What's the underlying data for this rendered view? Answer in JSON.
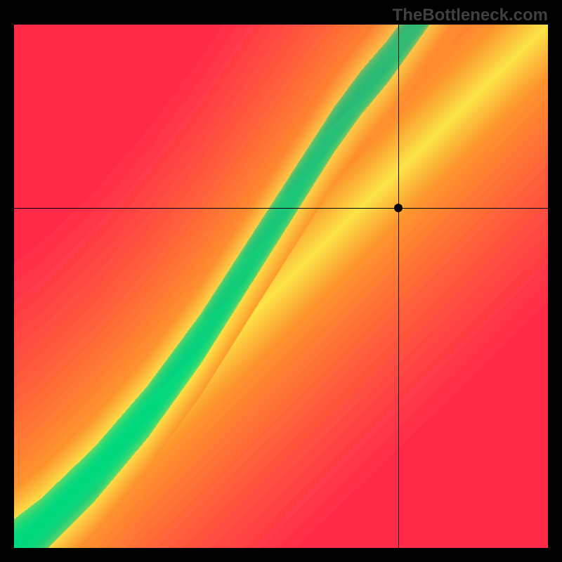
{
  "watermark": "TheBottleneck.com",
  "chart_data": {
    "type": "heatmap",
    "title": "",
    "xlabel": "",
    "ylabel": "",
    "xlim": [
      0,
      1
    ],
    "ylim": [
      0,
      1
    ],
    "marker": {
      "x": 0.72,
      "y": 0.65
    },
    "crosshair": {
      "x": 0.72,
      "y": 0.65
    },
    "optimal_curve": [
      {
        "x": 0.0,
        "y": 0.0
      },
      {
        "x": 0.05,
        "y": 0.04
      },
      {
        "x": 0.1,
        "y": 0.09
      },
      {
        "x": 0.15,
        "y": 0.14
      },
      {
        "x": 0.2,
        "y": 0.2
      },
      {
        "x": 0.25,
        "y": 0.26
      },
      {
        "x": 0.3,
        "y": 0.33
      },
      {
        "x": 0.35,
        "y": 0.4
      },
      {
        "x": 0.4,
        "y": 0.48
      },
      {
        "x": 0.45,
        "y": 0.56
      },
      {
        "x": 0.5,
        "y": 0.64
      },
      {
        "x": 0.55,
        "y": 0.72
      },
      {
        "x": 0.6,
        "y": 0.8
      },
      {
        "x": 0.65,
        "y": 0.87
      },
      {
        "x": 0.7,
        "y": 0.93
      },
      {
        "x": 0.75,
        "y": 1.0
      }
    ],
    "colors": {
      "optimal": "#00d97e",
      "warn": "#f9e547",
      "mid": "#ff9c2a",
      "bad": "#ff2a4a"
    },
    "grid": false,
    "legend": false
  }
}
